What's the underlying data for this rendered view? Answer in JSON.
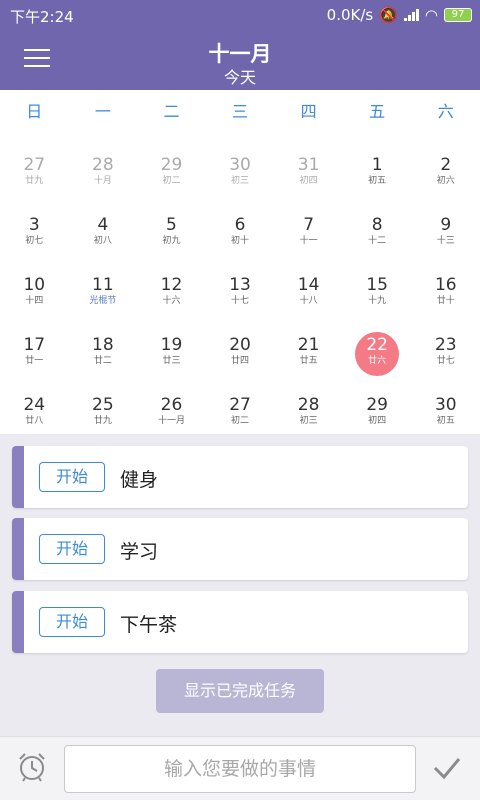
{
  "status": {
    "time": "下午2:24",
    "net": "0.0K/s",
    "battery": "97"
  },
  "appbar": {
    "title": "十一月",
    "today": "今天"
  },
  "weekdays": [
    "日",
    "一",
    "二",
    "三",
    "四",
    "五",
    "六"
  ],
  "calendar": {
    "weeks": [
      [
        {
          "d": "27",
          "l": "廿九",
          "other": true
        },
        {
          "d": "28",
          "l": "十月",
          "other": true
        },
        {
          "d": "29",
          "l": "初二",
          "other": true
        },
        {
          "d": "30",
          "l": "初三",
          "other": true
        },
        {
          "d": "31",
          "l": "初四",
          "other": true
        },
        {
          "d": "1",
          "l": "初五"
        },
        {
          "d": "2",
          "l": "初六"
        }
      ],
      [
        {
          "d": "3",
          "l": "初七"
        },
        {
          "d": "4",
          "l": "初八"
        },
        {
          "d": "5",
          "l": "初九"
        },
        {
          "d": "6",
          "l": "初十"
        },
        {
          "d": "7",
          "l": "十一"
        },
        {
          "d": "8",
          "l": "十二"
        },
        {
          "d": "9",
          "l": "十三"
        }
      ],
      [
        {
          "d": "10",
          "l": "十四"
        },
        {
          "d": "11",
          "l": "光棍节",
          "holiday": true
        },
        {
          "d": "12",
          "l": "十六"
        },
        {
          "d": "13",
          "l": "十七"
        },
        {
          "d": "14",
          "l": "十八"
        },
        {
          "d": "15",
          "l": "十九"
        },
        {
          "d": "16",
          "l": "廿十"
        }
      ],
      [
        {
          "d": "17",
          "l": "廿一"
        },
        {
          "d": "18",
          "l": "廿二"
        },
        {
          "d": "19",
          "l": "廿三"
        },
        {
          "d": "20",
          "l": "廿四"
        },
        {
          "d": "21",
          "l": "廿五"
        },
        {
          "d": "22",
          "l": "廿六",
          "selected": true
        },
        {
          "d": "23",
          "l": "廿七"
        }
      ],
      [
        {
          "d": "24",
          "l": "廿八"
        },
        {
          "d": "25",
          "l": "廿九"
        },
        {
          "d": "26",
          "l": "十一月"
        },
        {
          "d": "27",
          "l": "初二"
        },
        {
          "d": "28",
          "l": "初三"
        },
        {
          "d": "29",
          "l": "初四"
        },
        {
          "d": "30",
          "l": "初五"
        }
      ]
    ]
  },
  "tasks": [
    {
      "start": "开始",
      "name": "健身"
    },
    {
      "start": "开始",
      "name": "学习"
    },
    {
      "start": "开始",
      "name": "下午茶"
    }
  ],
  "show_done": "显示已完成任务",
  "input": {
    "placeholder": "输入您要做的事情"
  },
  "colors": {
    "primary": "#7066ad",
    "accent": "#3d8bd6",
    "selected": "#f47a86"
  }
}
